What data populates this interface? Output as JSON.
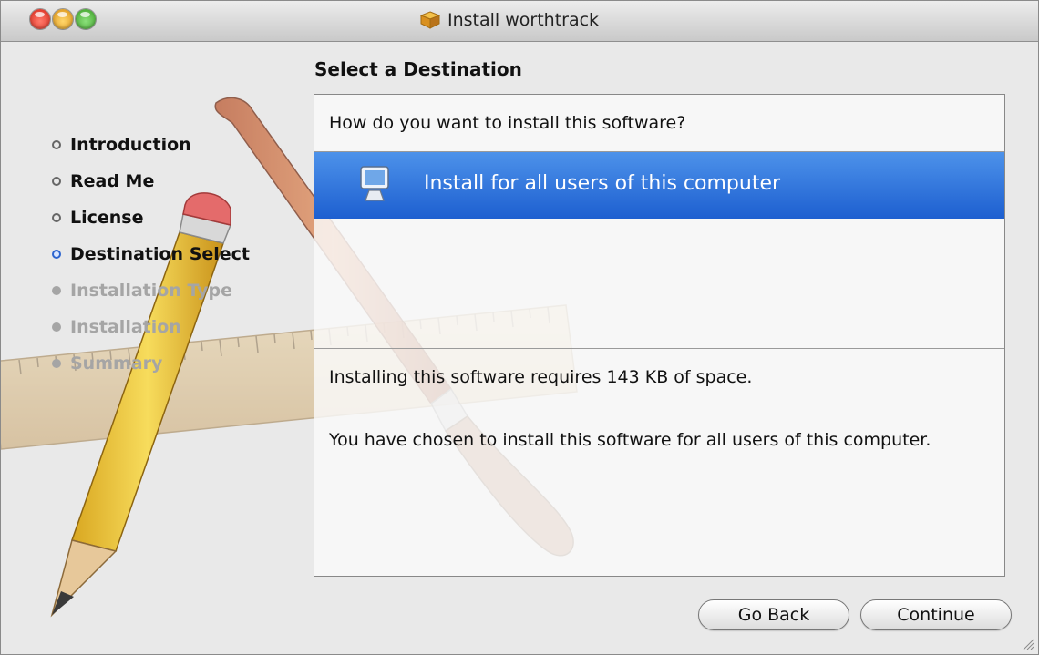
{
  "window": {
    "title": "Install worthtrack"
  },
  "sidebar": {
    "steps": [
      {
        "label": "Introduction",
        "state": "done"
      },
      {
        "label": "Read Me",
        "state": "done"
      },
      {
        "label": "License",
        "state": "done"
      },
      {
        "label": "Destination Select",
        "state": "current"
      },
      {
        "label": "Installation Type",
        "state": "future"
      },
      {
        "label": "Installation",
        "state": "future"
      },
      {
        "label": "Summary",
        "state": "future"
      }
    ]
  },
  "main": {
    "heading": "Select a Destination",
    "question": "How do you want to install this software?",
    "option": {
      "label": "Install for all users of this computer",
      "icon": "computer-icon",
      "selected": true
    },
    "space_text": "Installing this software requires 143 KB of space.",
    "chosen_text": "You have chosen to install this software for all users of this computer."
  },
  "buttons": {
    "back": "Go Back",
    "continue": "Continue"
  },
  "colors": {
    "selection": "#2f74dc",
    "current_step_bullet": "#2d65cf"
  }
}
